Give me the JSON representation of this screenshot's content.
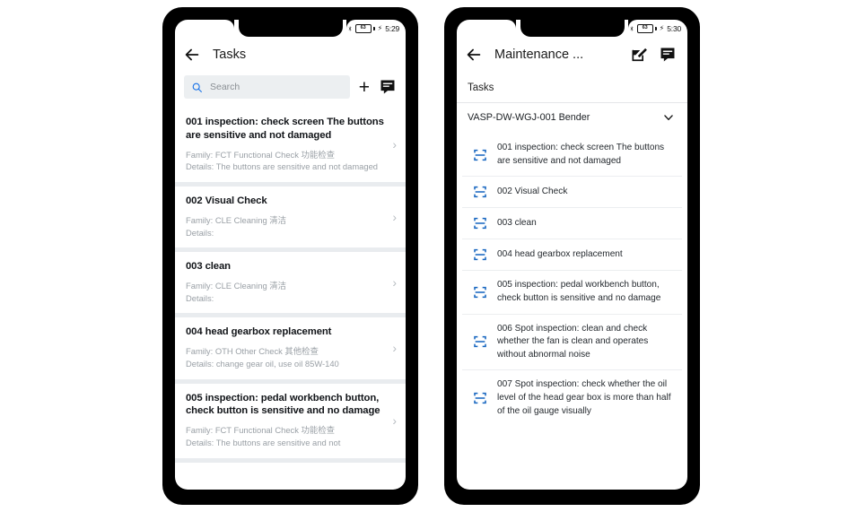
{
  "left_phone": {
    "status_bar": {
      "bluetooth_icon": "bluetooth-icon",
      "battery_level": "63",
      "charging_icon": "charging-bolt-icon",
      "time": "5:29"
    },
    "appbar": {
      "back_icon": "back-arrow-icon",
      "title": "Tasks",
      "comment_icon": "comment-icon"
    },
    "search": {
      "icon": "search-icon",
      "placeholder": "Search",
      "value": "",
      "add_label": "+",
      "add_icon": "plus-icon"
    },
    "tasks": [
      {
        "title": "001 inspection:  check screen The buttons are sensitive and not damaged",
        "family": "Family: FCT Functional Check 功能检查",
        "details": "Details: The buttons are sensitive and not damaged",
        "chevron": "›"
      },
      {
        "title": "002 Visual Check",
        "family": "Family: CLE Cleaning 清洁",
        "details": "Details:",
        "chevron": "›"
      },
      {
        "title": "003 clean",
        "family": "Family: CLE Cleaning 清洁",
        "details": "Details:",
        "chevron": "›"
      },
      {
        "title": "004 head gearbox replacement",
        "family": "Family: OTH Other Check 其他检查",
        "details": "Details: change gear oil, use oil 85W-140",
        "chevron": "›"
      },
      {
        "title": "005 inspection:  pedal workbench button, check button is sensitive and no damage",
        "family": "Family: FCT Functional Check 功能检查",
        "details": "Details: The buttons are sensitive and not",
        "chevron": "›"
      }
    ]
  },
  "right_phone": {
    "status_bar": {
      "bluetooth_icon": "bluetooth-icon",
      "battery_level": "63",
      "charging_icon": "charging-bolt-icon",
      "time": "5:30"
    },
    "appbar": {
      "back_icon": "back-arrow-icon",
      "title": "Maintenance ...",
      "edit_icon": "edit-square-icon",
      "comment_icon": "comment-icon"
    },
    "section_label": "Tasks",
    "group": {
      "name": "VASP-DW-WGJ-001 Bender",
      "chevron_icon": "chevron-down-icon"
    },
    "items": [
      {
        "icon": "scan-icon",
        "text": "001 inspection:  check screen The buttons are sensitive and not damaged"
      },
      {
        "icon": "scan-icon",
        "text": "002 Visual Check"
      },
      {
        "icon": "scan-icon",
        "text": "003 clean"
      },
      {
        "icon": "scan-icon",
        "text": "004 head gearbox replacement"
      },
      {
        "icon": "scan-icon",
        "text": "005 inspection:  pedal workbench button, check button is sensitive and no damage"
      },
      {
        "icon": "scan-icon",
        "text": "006 Spot inspection: clean and check whether the fan is clean and operates without abnormal noise"
      },
      {
        "icon": "scan-icon",
        "text": "007 Spot inspection: check whether the oil level of the head gear box is more than half of the oil gauge visually"
      }
    ]
  },
  "colors": {
    "accent_blue": "#1a73e8",
    "scan_icon_blue": "#1565c0",
    "card_bg": "#ffffff",
    "list_bg": "#e9ecef",
    "muted_text": "#9aa0a6",
    "frame_black": "#000000"
  }
}
